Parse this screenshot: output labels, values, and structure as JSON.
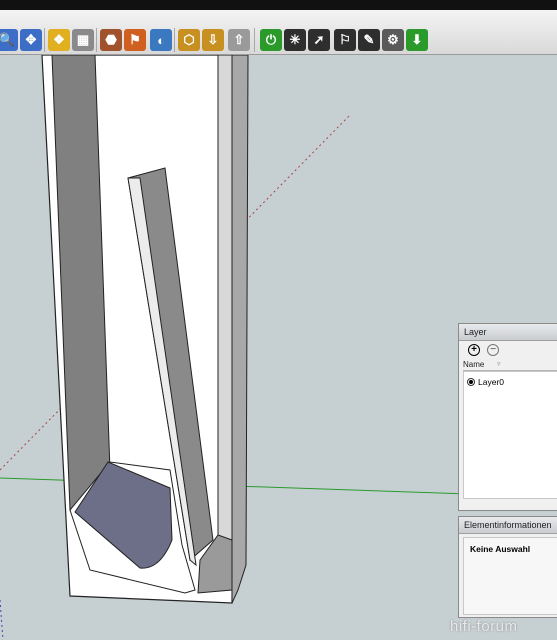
{
  "toolbar": {
    "buttons": [
      {
        "name": "zoom-icon",
        "color": "#3c6ec8",
        "glyph": "🔍"
      },
      {
        "name": "zoom-extents-icon",
        "color": "#3c6ec8",
        "glyph": "✥"
      },
      {
        "name": "components-icon",
        "color": "#e0b020",
        "glyph": "❖"
      },
      {
        "name": "materials-icon",
        "color": "#8a8a8a",
        "glyph": "▦"
      },
      {
        "name": "styles-icon",
        "color": "#a0522d",
        "glyph": "⬣"
      },
      {
        "name": "location-icon",
        "color": "#d06020",
        "glyph": "⚑"
      },
      {
        "name": "shadows-icon",
        "color": "#3a78c0",
        "glyph": "◐"
      },
      {
        "name": "send-to-layout-icon",
        "color": "#c89020",
        "glyph": "⬡"
      },
      {
        "name": "get-models-icon",
        "color": "#c89020",
        "glyph": "⇩"
      },
      {
        "name": "share-model-icon",
        "color": "#9a9a9a",
        "glyph": "⇧"
      },
      {
        "name": "power-icon",
        "color": "#2a9a2a",
        "glyph": "⏻"
      },
      {
        "name": "sparkle-icon",
        "color": "#2e2e2e",
        "glyph": "✳"
      },
      {
        "name": "select-arrow-icon",
        "color": "#2e2e2e",
        "glyph": "➚"
      },
      {
        "name": "flag-icon",
        "color": "#2e2e2e",
        "glyph": "⚐"
      },
      {
        "name": "paint-icon",
        "color": "#2e2e2e",
        "glyph": "✎"
      },
      {
        "name": "gear-icon",
        "color": "#5a5a5a",
        "glyph": "⚙"
      },
      {
        "name": "download-icon",
        "color": "#2a9a2a",
        "glyph": "⬇"
      }
    ]
  },
  "layer_panel": {
    "title": "Layer",
    "column_name": "Name",
    "layers": [
      {
        "label": "Layer0",
        "active": true
      }
    ]
  },
  "entity_info_panel": {
    "title": "Elementinformationen",
    "status": "Keine Auswahl"
  },
  "watermark": "hifi-forum"
}
